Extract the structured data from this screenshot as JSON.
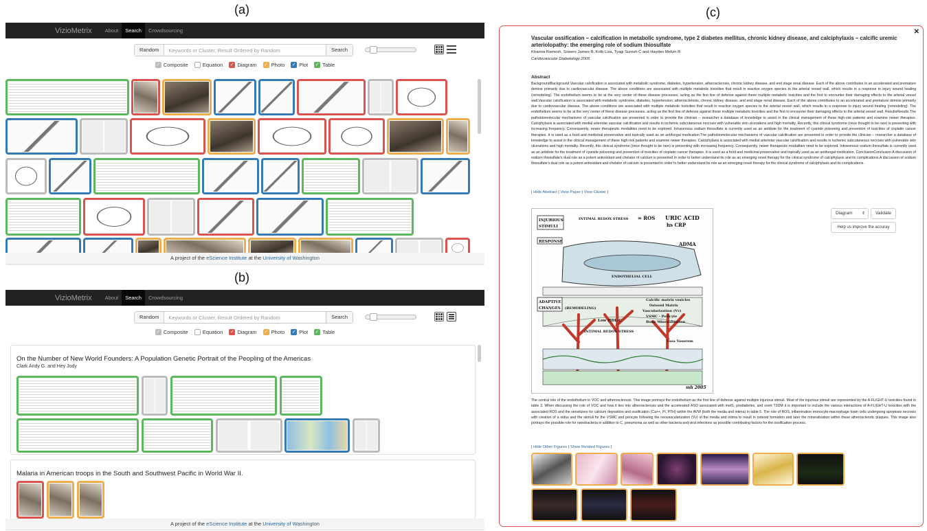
{
  "labels": {
    "a": "(a)",
    "b": "(b)",
    "c": "(c)"
  },
  "colors": {
    "diagram": "#d9534f",
    "photo": "#f0ad4e",
    "plot": "#337ab7",
    "table": "#5cb85c",
    "composite": "#bbbbbb"
  },
  "nav": {
    "brand": "VizioMetrix",
    "items": [
      "About",
      "Search",
      "Crowdsourcing"
    ]
  },
  "search": {
    "random_label": "Random",
    "placeholder": "Keywords or Cluster, Result Ordered by Random",
    "search_label": "Search"
  },
  "filters": [
    {
      "label": "Composite",
      "checked": true,
      "color": "#bbbbbb"
    },
    {
      "label": "Equation",
      "checked": false,
      "color": "#ffffff"
    },
    {
      "label": "Diagram",
      "checked": true,
      "color": "#d9534f"
    },
    {
      "label": "Photo",
      "checked": true,
      "color": "#f0ad4e"
    },
    {
      "label": "Plot",
      "checked": true,
      "color": "#337ab7"
    },
    {
      "label": "Table",
      "checked": true,
      "color": "#5cb85c"
    }
  ],
  "footer": {
    "prefix": "A project of the",
    "org": "eScience Institute",
    "mid": "at the",
    "univ": "University of Washington"
  },
  "results": [
    {
      "title": "On the Number of New World Founders: A Population Genetic Portrait of the Peopling of the Americas",
      "authors": "Clark Andy G. and Hey Jody"
    },
    {
      "title": "Malaria in American troops in the South and Southwest Pacific in World War II.",
      "authors": ""
    }
  ],
  "detail": {
    "title": "Vascular ossification – calcification in metabolic syndrome, type 2 diabetes mellitus, chronic kidney disease, and calciphylaxis – calcific uremic arteriolopathy: the emerging role of sodium thiosulfate",
    "authors": "Kharma Ramesh, Sowers James R, Kolb Lisa, Tyagi Suresh C and Hayden Melvin R",
    "journal": "Cardiovascular Diabetology 2005",
    "abstract_heading": "Abstract",
    "abstract": "BackgroundBackground Vascular calcification is associated with metabolic syndrome, diabetes, hypertension, atherosclerosis, chronic kidney disease, and end stage renal disease. Each of the above contributes to an accelerated and premature demise primarily due to cardiovascular disease. The above conditions are associated with multiple metabolic toxicities that result in reactive oxygen species to the arterial vessel wall, which results in a response to injury wound healing (remodeling). The endothelium seems to be at the very center of these disease processes, acting as the first line of defense against these multiple metabolic toxicities and the first to encounter their damaging effects to the arterial vessel wall.Vascular calcification is associated with metabolic syndrome, diabetes, hypertension, atherosclerosis, chronic kidney disease, and end stage renal disease. Each of the above contributes to an accelerated and premature demise primarily due to cardiovascular disease. The above conditions are associated with multiple metabolic toxicities that result in reactive oxygen species to the arterial vessel wall, which results in a response to injury wound healing (remodeling). The endothelium seems to be at the very center of these disease processes, acting as the first line of defense against these multiple metabolic toxicities and the first to encounter their damaging effects to the arterial vessel wall. ResultsResults The pathobiomolecular mechanisms of vascular calcification are presented in order to provide the clinician – researcher a database of knowledge to assist in the clinical management of these high-risk patients and examine newer therapies. Calciphylaxis is associated with medial arteriolar vascular calcification and results in ischemic subcutaneous necrosis with vulnerable skin ulcerations and high mortality. Recently, this clinical syndrome (once thought to be rare) is presenting with increasing frequency. Consequently, newer therapeutic modalities need to be explored. Intravenous sodium thiosulfate is currently used as an antidote for the treatment of cyanide poisoning and prevention of toxicities of cisplatin cancer therapies. It is used as a food and medicinal preservative and topically used as an antifungal medication.The pathobiomolecular mechanisms of vascular calcification are presented in order to provide the clinician – researcher a database of knowledge to assist in the clinical management of these high-risk patients and examine newer therapies. Calciphylaxis is associated with medial arteriolar vascular calcification and results in ischemic subcutaneous necrosis with vulnerable skin ulcerations and high mortality. Recently, this clinical syndrome (once thought to be rare) is presenting with increasing frequency. Consequently, newer therapeutic modalities need to be explored. Intravenous sodium thiosulfate is currently used as an antidote for the treatment of cyanide poisoning and prevention of toxicities of cisplatin cancer therapies. It is used as a food and medicinal preservative and topically used as an antifungal medication. ConclusionConclusion A discussion of sodium thiosulfate's dual role as a potent antioxidant and chelator of calcium is presented in order to better understand its role as an emerging novel therapy for the clinical syndrome of calciphylaxis and its complications.A discussion of sodium thiosulfate's dual role as a potent antioxidant and chelator of calcium is presented in order to better understand its role as an emerging novel therapy for the clinical syndrome of calciphylaxis and its complications.",
    "links": {
      "hide_abstract": "Hide Abstract",
      "view_paper": "View Paper",
      "view_cluster": "View Cluster"
    },
    "figure_select": "Diagram",
    "validate_label": "Validate",
    "improve_label": "Help us improve the accuray",
    "caption": "The central role of the endothelium in VOC and atherosclerosis. This image portrays the endothelium as the first line of defense against multiple injurious stimuli. Most of the injurious stimuli are represented by the A-FLIGHT-U toxicities found in table 3. When discussing the role of VOC and how it ties into atherosclerosis and the accelerated ASO associated with metS, prediabetes, and overt T2DM it is important to include the various interactions of A-FLIGHT-U toxicities with the associated ROS and the sensitizers for calcium deposition and ossification (Ca++, Pi, PTH) within the AVW (both the media and intima) in table 5. The role of ROS, inflammation monocyte-macrophage foam cells undergoing apoptosis necrosis with creation of a nidus and the stimuli for the VSMC and pericyte following the neovascularization (Vv) of the media and intima to result in osteoid formation and later the mineralization within these atherosclerotic plaques. This image also portrays the possible role for nanobacteria in addition to C. pneumonia as well as other bacteria and viral infections as possible contributing factors for the ossification process.",
    "figure_links": {
      "hide_other": "Hide Other Figures",
      "show_related": "Show Related Figures"
    },
    "figure_text": {
      "injurious": "INJURIOUS",
      "stimuli": "STIMULI",
      "stress": "INTIMAL REDOX STRESS",
      "ros": "= ROS",
      "uric": "URIC ACID",
      "hscrp": "hs CRP",
      "response": "RESPONSE",
      "adma": "ADMA",
      "endo": "ENDOTHELIAL CELL",
      "adaptive": "ADAPTIVE",
      "changes": "CHANGES",
      "remodeling": "(REMODELING)",
      "calcific": "Calcific matrix vesicles",
      "osteoid": "Osteoid Matrix",
      "vascular": "Vascularization (Vv)",
      "vsmc": "VSMC - Pericyte",
      "bone": "Bone Mineralization",
      "lowhdl": "Low HDL-C",
      "stress2": "INTIMAL REDOX STRESS",
      "vasa": "Vasa Vasorum",
      "mh": "mh 2005"
    }
  }
}
